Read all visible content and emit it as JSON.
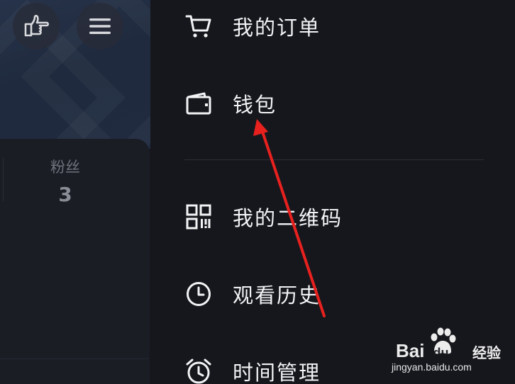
{
  "left_panel": {
    "stats": {
      "fans_label": "粉丝",
      "fans_value": "3"
    },
    "icons": [
      "pointing-hand-icon",
      "hamburger-menu-icon"
    ]
  },
  "drawer": {
    "items": [
      {
        "label": "我的订单",
        "icon": "cart-icon"
      },
      {
        "label": "钱包",
        "icon": "wallet-icon"
      },
      {
        "label": "我的二维码",
        "icon": "qr-code-icon"
      },
      {
        "label": "观看历史",
        "icon": "clock-icon"
      },
      {
        "label": "时间管理",
        "icon": "alarm-clock-icon"
      }
    ]
  },
  "annotation": {
    "color": "#e8211f"
  },
  "watermark": {
    "brand": "Bai",
    "brand_suffix": "du",
    "product": "经验",
    "url": "jingyan.baidu.com"
  }
}
